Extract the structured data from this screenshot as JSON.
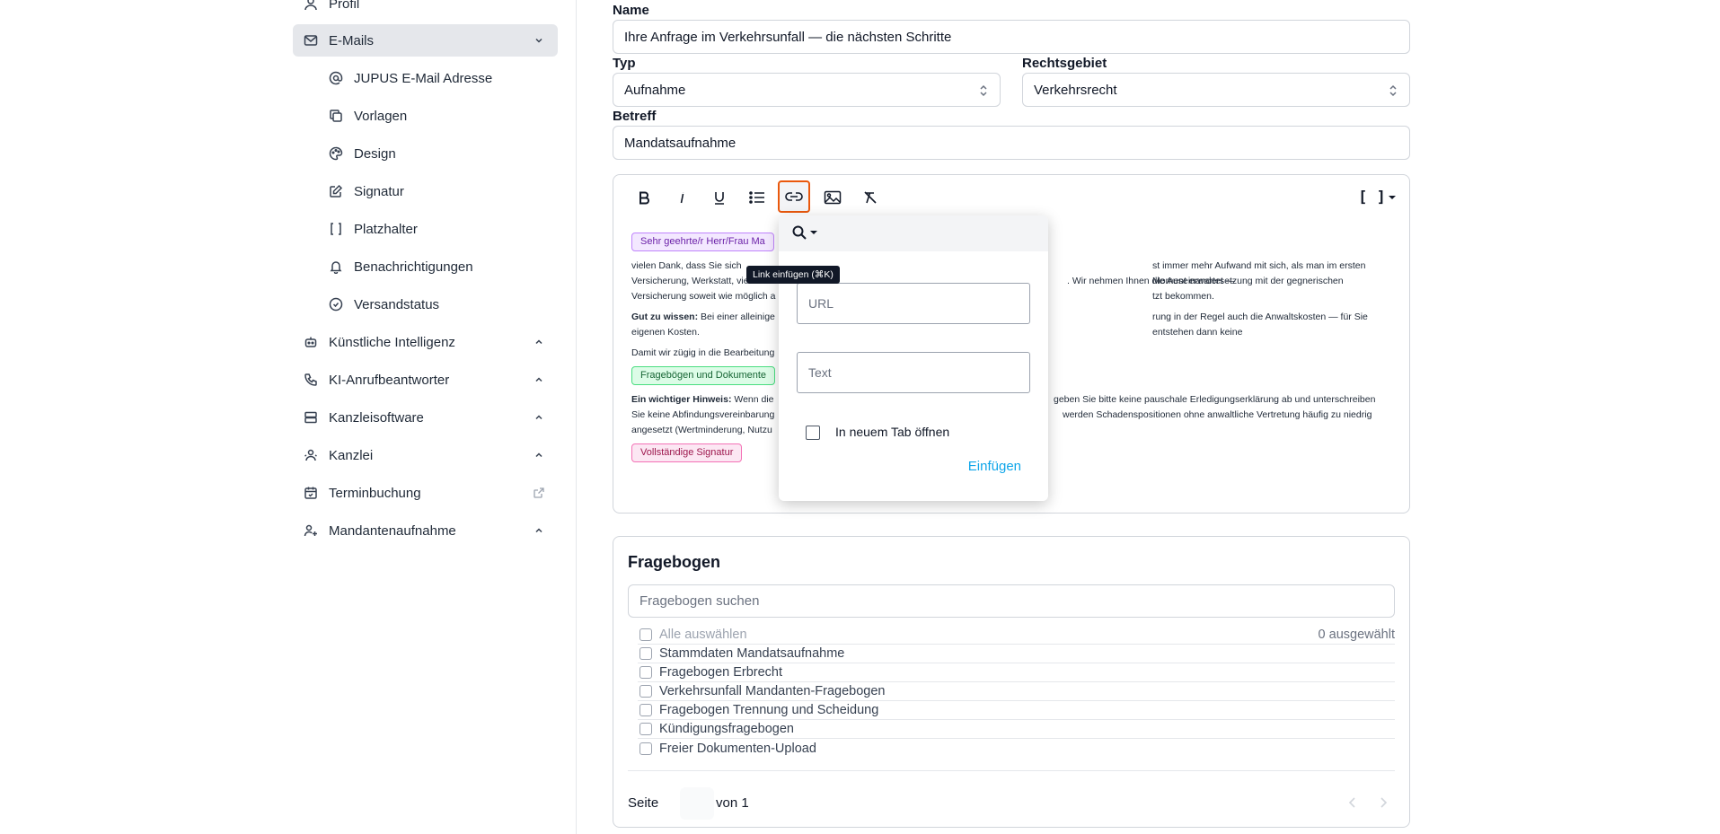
{
  "sidebar": {
    "profil": "Profil",
    "emails": "E-Mails",
    "email_sub": [
      {
        "label": "JUPUS E-Mail Adresse",
        "icon": "at-icon"
      },
      {
        "label": "Vorlagen",
        "icon": "copy-icon"
      },
      {
        "label": "Design",
        "icon": "palette-icon"
      },
      {
        "label": "Signatur",
        "icon": "signature-icon"
      },
      {
        "label": "Platzhalter",
        "icon": "brackets-icon"
      },
      {
        "label": "Benachrichtigungen",
        "icon": "bell-icon"
      },
      {
        "label": "Versandstatus",
        "icon": "check-circle-icon"
      }
    ],
    "ki": "Künstliche Intelligenz",
    "ki_ab": "KI-Anrufbeantworter",
    "kanzleisoftware": "Kanzleisoftware",
    "kanzlei": "Kanzlei",
    "terminbuchung": "Terminbuchung",
    "mandantenaufnahme": "Mandantenaufnahme"
  },
  "form": {
    "name_label": "Name",
    "name_value": "Ihre Anfrage im Verkehrsunfall — die nächsten Schritte",
    "typ_label": "Typ",
    "typ_value": "Aufnahme",
    "rechtsgebiet_label": "Rechtsgebiet",
    "rechtsgebiet_value": "Verkehrsrecht",
    "betreff_label": "Betreff",
    "betreff_value": "Mandatsaufnahme"
  },
  "editor": {
    "placeholder_button": "[ ]",
    "pill_greeting": "Sehr geehrte/r Herr/Frau Ma",
    "p1a": "vielen Dank, dass Sie sich",
    "p1b": "st immer mehr Aufwand mit sich, als man im ersten Moment erwartet —",
    "p1c": "Versicherung, Werkstatt, vielleich",
    "p1d": ". Wir nehmen Ihnen die Auseinandersetzung mit der gegnerischen",
    "p1e": "Versicherung soweit wie möglich a",
    "p1f": "tzt bekommen.",
    "p2_bold": "Gut zu wissen:",
    "p2a": " Bei einer alleinige",
    "p2b": "rung in der Regel auch die Anwaltskosten — für Sie entstehen dann keine",
    "p2c": "eigenen Kosten.",
    "p3": "Damit wir zügig in die Bearbeitung",
    "pill_fragebogen": "Fragebögen und Dokumente",
    "p4_bold": "Ein wichtiger Hinweis:",
    "p4a": " Wenn die",
    "p4b": "geben Sie bitte keine pauschale Erledigungserklärung ab und unterschreiben",
    "p4c": "Sie keine Abfindungsvereinbarung",
    "p4d": "werden Schadenspositionen ohne anwaltliche Vertretung häufig zu niedrig",
    "p4e": "angesetzt (Wertminderung, Nutzu",
    "pill_signatur": "Vollständige Signatur"
  },
  "link_popup": {
    "tooltip": "Link einfügen (⌘K)",
    "url_placeholder": "URL",
    "text_placeholder": "Text",
    "new_tab_label": "In neuem Tab öffnen",
    "insert_button": "Einfügen"
  },
  "fragebogen": {
    "title": "Fragebogen",
    "search_placeholder": "Fragebogen suchen",
    "select_all": "Alle auswählen",
    "selected_count": "0 ausgewählt",
    "items": [
      "Stammdaten Mandatsaufnahme",
      "Fragebogen Erbrecht",
      "Verkehrsunfall Mandanten-Fragebogen",
      "Fragebogen Trennung und Scheidung",
      "Kündigungsfragebogen",
      "Freier Dokumenten-Upload"
    ],
    "page_label": "Seite",
    "page_of": "von 1"
  }
}
